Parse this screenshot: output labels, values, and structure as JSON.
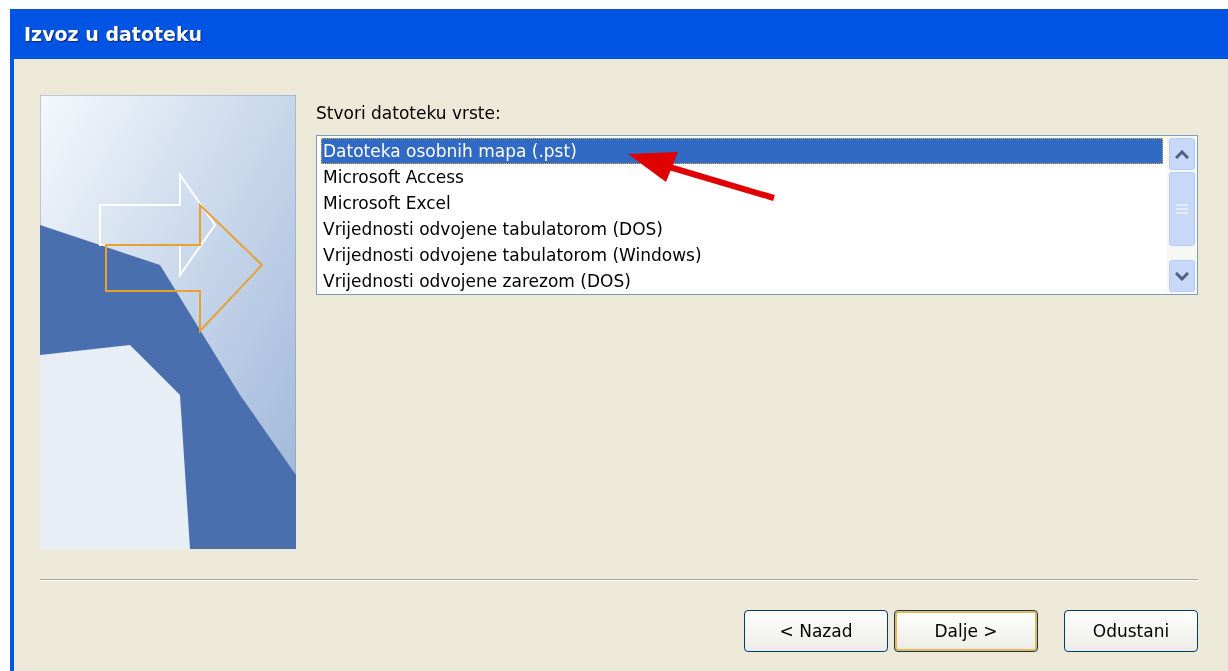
{
  "window": {
    "title": "Izvoz u datoteku"
  },
  "file_type": {
    "label": "Stvori datoteku vrste:",
    "items": [
      {
        "label": "Datoteka osobnih mapa (.pst)",
        "selected": true
      },
      {
        "label": "Microsoft Access",
        "selected": false
      },
      {
        "label": "Microsoft Excel",
        "selected": false
      },
      {
        "label": "Vrijednosti odvojene tabulatorom (DOS)",
        "selected": false
      },
      {
        "label": "Vrijednosti odvojene tabulatorom (Windows)",
        "selected": false
      },
      {
        "label": "Vrijednosti odvojene zarezom (DOS)",
        "selected": false
      }
    ]
  },
  "buttons": [
    {
      "label": "< Nazad",
      "default": false
    },
    {
      "label": "Dalje >",
      "default": true
    },
    {
      "label": "Odustani",
      "default": false
    }
  ]
}
